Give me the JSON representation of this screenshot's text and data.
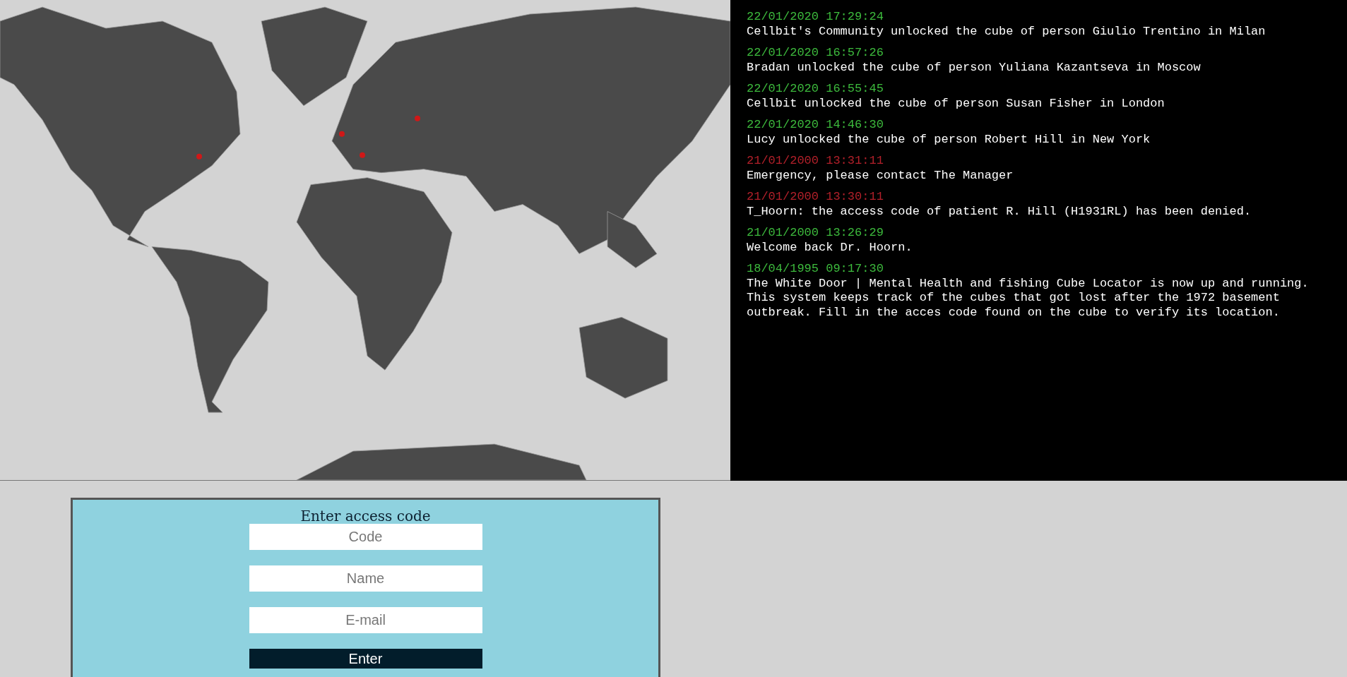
{
  "log": [
    {
      "kind": "ok",
      "time": "22/01/2020 17:29:24",
      "message": "Cellbit's Community unlocked the cube of person Giulio Trentino in Milan"
    },
    {
      "kind": "ok",
      "time": "22/01/2020 16:57:26",
      "message": "Bradan unlocked the cube of person Yuliana Kazantseva in Moscow"
    },
    {
      "kind": "ok",
      "time": "22/01/2020 16:55:45",
      "message": "Cellbit unlocked the cube of person Susan Fisher in London"
    },
    {
      "kind": "ok",
      "time": "22/01/2020 14:46:30",
      "message": "Lucy unlocked the cube of person Robert Hill in New York"
    },
    {
      "kind": "alert",
      "time": "21/01/2000 13:31:11",
      "message": "Emergency, please contact The Manager"
    },
    {
      "kind": "alert",
      "time": "21/01/2000 13:30:11",
      "message": "T_Hoorn: the access code of patient R. Hill (H1931RL) has been denied."
    },
    {
      "kind": "ok",
      "time": "21/01/2000 13:26:29",
      "message": "Welcome back Dr. Hoorn."
    },
    {
      "kind": "ok",
      "time": "18/04/1995 09:17:30",
      "message": "The White Door | Mental Health and fishing Cube Locator is now up and running. This system keeps track of the cubes that got lost after the 1972 basement outbreak. Fill in the acces code found on the cube to verify its location."
    }
  ],
  "form": {
    "title": "Enter access code",
    "fields": [
      {
        "placeholder": "Code"
      },
      {
        "placeholder": "Name"
      },
      {
        "placeholder": "E-mail"
      }
    ],
    "button": "Enter"
  }
}
